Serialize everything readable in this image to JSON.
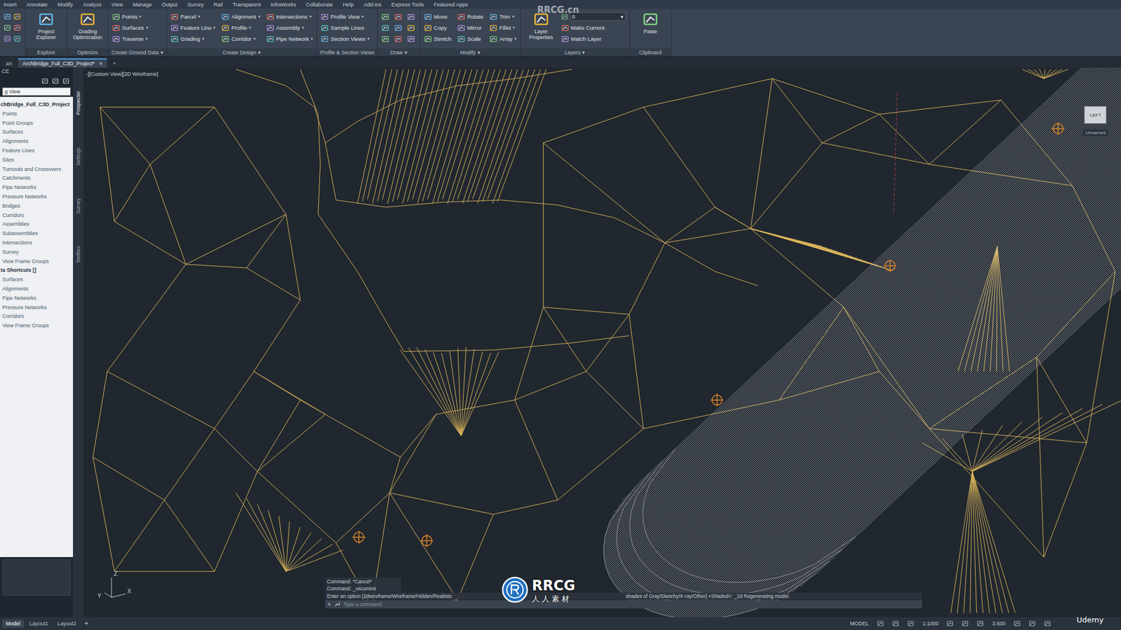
{
  "menu": [
    "Insert",
    "Annotate",
    "Modify",
    "Analyze",
    "View",
    "Manage",
    "Output",
    "Survey",
    "Rail",
    "Transparent",
    "InfraWorks",
    "Collaborate",
    "Help",
    "Add-ins",
    "Express Tools",
    "Featured Apps"
  ],
  "ribbon": {
    "panels": [
      {
        "title": "Explore",
        "kind": "tools",
        "tools": [
          {
            "label": "Project Explorer",
            "kind": "large"
          }
        ]
      },
      {
        "title": "Optimize",
        "kind": "tools",
        "tools": [
          {
            "label": "Grading Optimization",
            "kind": "large"
          }
        ]
      },
      {
        "title": "Create Ground Data",
        "caret": "▾",
        "kind": "tools",
        "tools": [
          {
            "label": "Points",
            "kind": "small",
            "caret": "▾"
          },
          {
            "label": "Surfaces",
            "kind": "small",
            "caret": "▾"
          },
          {
            "label": "Traverse",
            "kind": "small",
            "caret": "▾"
          }
        ]
      },
      {
        "title": "Create Design",
        "caret": "▾",
        "kind": "tools",
        "tools": [
          {
            "label": "Parcel",
            "kind": "small",
            "caret": "▾"
          },
          {
            "label": "Feature Line",
            "kind": "small",
            "caret": "▾"
          },
          {
            "label": "Grading",
            "kind": "small",
            "caret": "▾"
          },
          {
            "label": "Alignment",
            "kind": "small",
            "caret": "▾"
          },
          {
            "label": "Profile",
            "kind": "small",
            "caret": "▾"
          },
          {
            "label": "Corridor",
            "kind": "small",
            "caret": "▾"
          },
          {
            "label": "Intersections",
            "kind": "small",
            "caret": "▾"
          },
          {
            "label": "Assembly",
            "kind": "small",
            "caret": "▾"
          },
          {
            "label": "Pipe Network",
            "kind": "small",
            "caret": "▾"
          }
        ]
      },
      {
        "title": "Profile & Section Views",
        "kind": "tools",
        "tools": [
          {
            "label": "Profile View",
            "kind": "small",
            "caret": "▾"
          },
          {
            "label": "Sample Lines",
            "kind": "small"
          },
          {
            "label": "Section Views",
            "kind": "small",
            "caret": "▾"
          }
        ]
      },
      {
        "title": "Draw",
        "caret": "▾",
        "kind": "icons"
      },
      {
        "title": "Modify",
        "caret": "▾",
        "kind": "tools",
        "tools": [
          {
            "label": "Move",
            "kind": "small"
          },
          {
            "label": "Copy",
            "kind": "small"
          },
          {
            "label": "Stretch",
            "kind": "small"
          },
          {
            "label": "Rotate",
            "kind": "small"
          },
          {
            "label": "Mirror",
            "kind": "small"
          },
          {
            "label": "Scale",
            "kind": "small"
          },
          {
            "label": "Trim",
            "kind": "small",
            "caret": "▾"
          },
          {
            "label": "Fillet",
            "kind": "small",
            "caret": "▾"
          },
          {
            "label": "Array",
            "kind": "small",
            "caret": "▾"
          }
        ]
      },
      {
        "title": "Layers",
        "caret": "▾",
        "kind": "tools",
        "tools": [
          {
            "label": "Layer Properties",
            "kind": "large"
          },
          {
            "label": "0",
            "kind": "select",
            "caret": "▾"
          },
          {
            "label": "Make Current",
            "kind": "small"
          },
          {
            "label": "Match Layer",
            "kind": "small"
          }
        ]
      },
      {
        "title": "Clipboard",
        "kind": "tools",
        "tools": [
          {
            "label": "Paste",
            "kind": "large"
          }
        ]
      }
    ]
  },
  "file_tabs": [
    {
      "label": "art",
      "selected": false
    },
    {
      "label": "ArchBridge_Full_C3D_Project*",
      "selected": true,
      "close": "×"
    }
  ],
  "new_tab": "+",
  "toolspace": {
    "title": "CE",
    "view": "g View",
    "vertical_tabs": [
      {
        "label": "Prospector",
        "selected": true
      },
      {
        "label": "Settings",
        "selected": false
      },
      {
        "label": "Survey",
        "selected": false
      },
      {
        "label": "Toolbox",
        "selected": false
      }
    ],
    "items": [
      {
        "label": "chBridge_Full_C3D_Project",
        "kind": "root"
      },
      {
        "label": "Points",
        "kind": "node"
      },
      {
        "label": "Point Groups",
        "kind": "node"
      },
      {
        "label": "Surfaces",
        "kind": "node"
      },
      {
        "label": "Alignments",
        "kind": "node"
      },
      {
        "label": "Feature Lines",
        "kind": "node"
      },
      {
        "label": "Sites",
        "kind": "node"
      },
      {
        "label": "Turnouts and Crossovers",
        "kind": "node"
      },
      {
        "label": "Catchments",
        "kind": "node"
      },
      {
        "label": "Pipe Networks",
        "kind": "node"
      },
      {
        "label": "Pressure Networks",
        "kind": "node"
      },
      {
        "label": "Bridges",
        "kind": "node"
      },
      {
        "label": "Corridors",
        "kind": "node"
      },
      {
        "label": "Assemblies",
        "kind": "node"
      },
      {
        "label": "Subassemblies",
        "kind": "node"
      },
      {
        "label": "Intersections",
        "kind": "node"
      },
      {
        "label": "Survey",
        "kind": "node"
      },
      {
        "label": "View Frame Groups",
        "kind": "node"
      },
      {
        "label": "ta Shortcuts []",
        "kind": "root"
      },
      {
        "label": "Surfaces",
        "kind": "node"
      },
      {
        "label": "Alignments",
        "kind": "node"
      },
      {
        "label": "Pipe Networks",
        "kind": "node"
      },
      {
        "label": "Pressure Networks",
        "kind": "node"
      },
      {
        "label": "Corridors",
        "kind": "node"
      },
      {
        "label": "View Frame Groups",
        "kind": "node"
      }
    ]
  },
  "viewport": {
    "label": "-][Custom View][2D Wireframe]",
    "viewcube": {
      "face": "LEFT",
      "view_name": "Unnamed"
    },
    "ucs": {
      "x": "X",
      "y": "Y",
      "z": "Z"
    }
  },
  "command_line": {
    "history": [
      "Command: *Cancel*",
      "Command: _vscurrent"
    ],
    "prompt": [
      "Enter an option [2dwireframe/Wireframe/Hidden/Realistic",
      "shades of Gray/Sketchy/X-ray/Other] <Shaded>: _2d Regenerating model."
    ],
    "placeholder": "Type a command",
    "close": "×"
  },
  "layout_tabs": [
    {
      "label": "Model",
      "selected": true
    },
    {
      "label": "Layout1",
      "selected": false
    },
    {
      "label": "Layout2",
      "selected": false
    }
  ],
  "layout_add": "+",
  "status_bar": [
    "MODEL",
    "1:1000",
    "3.500"
  ],
  "watermarks": {
    "site": "RRCG.cn",
    "logo": "RRCG",
    "logo_sub": "人人素材",
    "course": "Udemy"
  }
}
